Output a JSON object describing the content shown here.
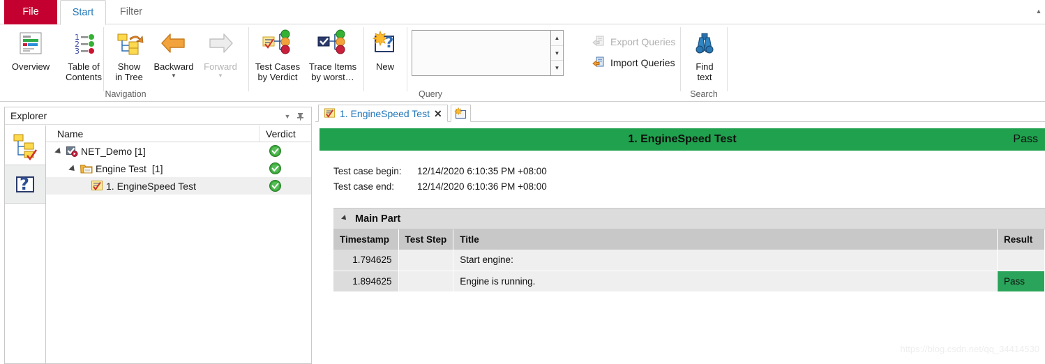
{
  "window": {
    "ribbon_tabs": [
      {
        "label": "File",
        "id": "file",
        "active": false
      },
      {
        "label": "Start",
        "id": "start",
        "active": true
      },
      {
        "label": "Filter",
        "id": "filter",
        "active": false
      }
    ]
  },
  "ribbon": {
    "groups": [
      {
        "label": "Navigation"
      },
      {
        "label": "Query"
      },
      {
        "label": "Search"
      }
    ],
    "buttons": {
      "overview": {
        "label_line1": "Overview",
        "label_line2": "",
        "icon": "overview-report-icon",
        "enabled": true
      },
      "table_of_contents": {
        "label_line1": "Table of",
        "label_line2": "Contents",
        "icon": "numbered-list-icon",
        "enabled": true
      },
      "show_in_tree": {
        "label_line1": "Show",
        "label_line2": "in Tree",
        "icon": "show-in-tree-icon",
        "enabled": true
      },
      "backward": {
        "label_line1": "Backward",
        "label_line2": "",
        "icon": "arrow-left-icon",
        "enabled": true,
        "has_dropdown": true
      },
      "forward": {
        "label_line1": "Forward",
        "label_line2": "",
        "icon": "arrow-right-icon",
        "enabled": false,
        "has_dropdown": true
      },
      "test_cases_by_verdict": {
        "label_line1": "Test Cases",
        "label_line2": "by Verdict",
        "icon": "test-cases-verdict-icon",
        "enabled": true
      },
      "trace_items_by_worst": {
        "label_line1": "Trace Items",
        "label_line2": "by worst…",
        "icon": "trace-items-icon",
        "enabled": true
      },
      "new_query": {
        "label_line1": "New",
        "label_line2": "",
        "icon": "new-query-icon",
        "enabled": true
      },
      "find_text": {
        "label_line1": "Find",
        "label_line2": "text",
        "icon": "binoculars-icon",
        "enabled": true
      },
      "export_queries": {
        "label": "Export Queries",
        "icon": "export-queries-icon",
        "enabled": false
      },
      "import_queries": {
        "label": "Import Queries",
        "icon": "import-queries-icon",
        "enabled": true
      }
    },
    "query_list": {
      "value": "",
      "spin_up": "▲",
      "spin_down": "▼",
      "spin_more": "▼"
    }
  },
  "explorer": {
    "title": "Explorer",
    "menu_icon": "chevron-down-icon",
    "pin_icon": "pin-icon",
    "strip_buttons": [
      {
        "name": "tree-view-button",
        "icon": "tree-view-icon",
        "active": true
      },
      {
        "name": "query-view-button",
        "icon": "question-document-icon",
        "active": false
      }
    ],
    "columns": {
      "name": "Name",
      "verdict": "Verdict"
    },
    "rows": [
      {
        "indent": 0,
        "expanded": true,
        "icon": "project-icon",
        "label": "NET_Demo",
        "count": "[1]",
        "verdict": "pass",
        "selected": false
      },
      {
        "indent": 1,
        "expanded": true,
        "icon": "folder-icon",
        "label": "Engine Test",
        "count": "[1]",
        "verdict": "pass",
        "selected": false
      },
      {
        "indent": 2,
        "expanded": false,
        "icon": "testcase-icon",
        "label": "1. EngineSpeed Test",
        "count": "",
        "verdict": "pass",
        "selected": true
      }
    ]
  },
  "document": {
    "tabs": [
      {
        "label": "1. EngineSpeed Test",
        "icon": "testcase-icon",
        "close_icon": "close-icon",
        "active": true
      }
    ],
    "new_tab_button": {
      "icon": "new-report-icon"
    }
  },
  "report": {
    "banner": {
      "title": "1. EngineSpeed Test",
      "verdict": "Pass",
      "color": "#1fa14e"
    },
    "meta": [
      {
        "key": "Test case begin:",
        "value": "12/14/2020 6:10:35 PM +08:00"
      },
      {
        "key": "Test case end:",
        "value": "12/14/2020 6:10:36 PM +08:00"
      }
    ],
    "section": {
      "title": "Main Part",
      "expanded": true
    },
    "table": {
      "columns": [
        "Timestamp",
        "Test Step",
        "Title",
        "Result"
      ],
      "rows": [
        {
          "timestamp": "1.794625",
          "test_step": "",
          "title": "Start engine:",
          "result": ""
        },
        {
          "timestamp": "1.894625",
          "test_step": "",
          "title": "Engine is running.",
          "result": "Pass"
        }
      ]
    },
    "watermark": "https://blog.csdn.net/qq_34414530"
  },
  "colors": {
    "file_tab": "#c3002f",
    "accent_blue": "#2176b8",
    "pass_green": "#1fa14e",
    "header_gray": "#c8c8c8"
  }
}
